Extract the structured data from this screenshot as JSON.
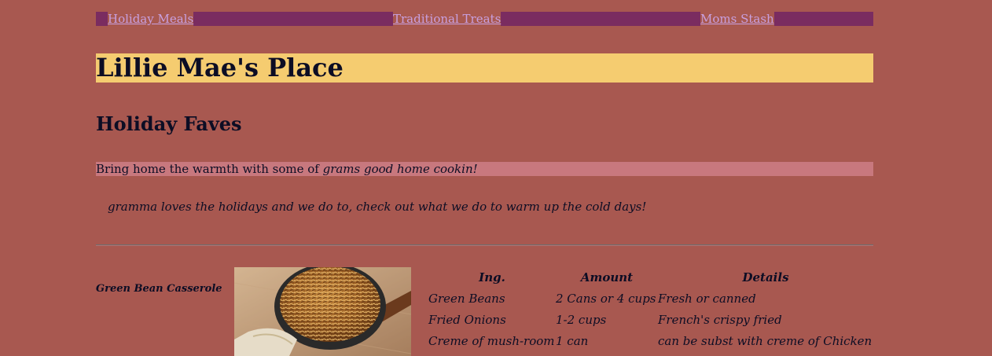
{
  "nav": {
    "items": [
      {
        "label": "Holiday Meals"
      },
      {
        "label": "Traditional Treats"
      },
      {
        "label": "Moms Stash"
      }
    ]
  },
  "site_title": "Lillie Mae's Place",
  "section_title": "Holiday Faves",
  "intro": {
    "text": "Bring home the warmth with some of ",
    "emphasis": "grams good home cookin!"
  },
  "note": "gramma loves the holidays and we do to, check out what we do to warm up the cold days!",
  "recipe": {
    "name": "Green Bean Casserole",
    "table": {
      "headers": [
        "Ing.",
        "Amount",
        "Details"
      ],
      "rows": [
        [
          "Green Beans",
          "2 Cans or 4 cups",
          "Fresh or canned"
        ],
        [
          "Fried Onions",
          "1-2 cups",
          "French's crispy fried"
        ],
        [
          "Creme of mush-room",
          "1 can",
          "can be subst with creme of Chicken"
        ]
      ]
    }
  },
  "colors": {
    "page_background": "#a85850",
    "nav_bar": "#7a2c60",
    "title_bar": "#f5cc70",
    "intro_highlight": "#c8787e",
    "link": "#c8a0e0"
  }
}
